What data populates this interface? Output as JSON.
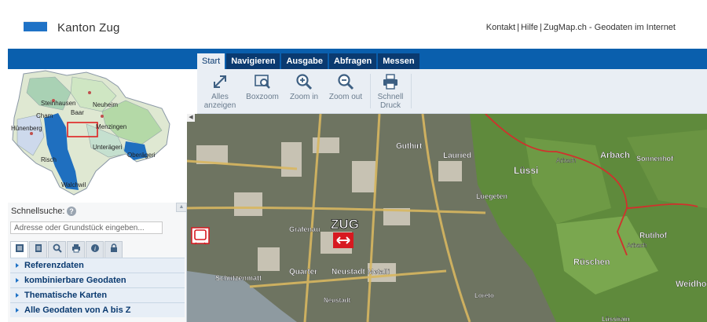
{
  "header": {
    "logo_text": "Kanton Zug",
    "links": [
      {
        "label": "Kontakt"
      },
      {
        "label": "Hilfe"
      },
      {
        "label": "ZugMap.ch - Geodaten im Internet"
      }
    ],
    "separator": "|"
  },
  "tabs": [
    {
      "label": "Start",
      "active": true
    },
    {
      "label": "Navigieren",
      "active": false
    },
    {
      "label": "Ausgabe",
      "active": false
    },
    {
      "label": "Abfragen",
      "active": false
    },
    {
      "label": "Messen",
      "active": false
    }
  ],
  "toolbar": {
    "buttons": [
      {
        "line1": "Alles",
        "line2": "anzeigen",
        "icon": "expand-arrows-icon"
      },
      {
        "line1": "Boxzoom",
        "line2": "",
        "icon": "boxzoom-icon"
      },
      {
        "line1": "Zoom in",
        "line2": "",
        "icon": "zoom-in-icon"
      },
      {
        "line1": "Zoom out",
        "line2": "",
        "icon": "zoom-out-icon"
      },
      {
        "line1": "Schnell",
        "line2": "Druck",
        "icon": "printer-icon"
      }
    ]
  },
  "overview_map": {
    "places": [
      "Steinhausen",
      "Neuheim",
      "Baar",
      "Cham",
      "Hünenberg",
      "Menzingen",
      "Unterägeri",
      "Oberägeri",
      "Risch",
      "Walchwil"
    ]
  },
  "search": {
    "label": "Schnellsuche:",
    "help": "?",
    "placeholder": "Adresse oder Grundstück eingeben..."
  },
  "panel_tabs": [
    "layers-icon",
    "document-icon",
    "search-icon",
    "printer-icon",
    "info-icon",
    "lock-icon"
  ],
  "accordion": [
    {
      "label": "Referenzdaten"
    },
    {
      "label": "kombinierbare Geodaten"
    },
    {
      "label": "Thematische Karten"
    },
    {
      "label": "Alle Geodaten von A bis Z"
    }
  ],
  "map": {
    "city_label": "ZUG",
    "labels": [
      "Guthirt",
      "Lauried",
      "Lüssi",
      "Arbach",
      "Sonnenhof",
      "Luegeten",
      "Grafenau",
      "Quarter",
      "Neustadt",
      "Metalli",
      "Schützenmatt",
      "Rutihof",
      "Rüschen",
      "Weidhof",
      "Loreto",
      "Lüssirain",
      "Neustadt",
      "Arbach",
      "Arbach"
    ]
  }
}
